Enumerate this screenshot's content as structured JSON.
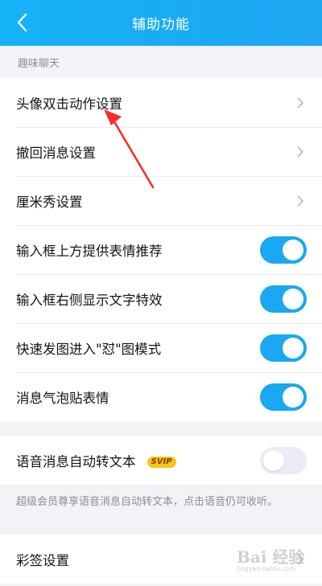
{
  "header": {
    "title": "辅助功能",
    "back_icon": "chevron-left-icon"
  },
  "sections": [
    {
      "header": "趣味聊天",
      "items": [
        {
          "label": "头像双击动作设置",
          "control": "chevron"
        },
        {
          "label": "撤回消息设置",
          "control": "chevron"
        },
        {
          "label": "厘米秀设置",
          "control": "chevron"
        },
        {
          "label": "输入框上方提供表情推荐",
          "control": "toggle",
          "on": true
        },
        {
          "label": "输入框右侧显示文字特效",
          "control": "toggle",
          "on": true
        },
        {
          "label": "快速发图进入\"怼\"图模式",
          "control": "toggle",
          "on": true
        },
        {
          "label": "消息气泡贴表情",
          "control": "toggle",
          "on": true
        }
      ]
    },
    {
      "items": [
        {
          "label": "语音消息自动转文本",
          "badge": "SVIP",
          "control": "toggle",
          "on": false
        }
      ],
      "note": "超级会员尊享语音消息自动转文本，点击语音仍可收听。"
    },
    {
      "items": [
        {
          "label": "彩签设置",
          "control": "chevron"
        }
      ]
    }
  ],
  "watermark": {
    "main": "Bai 经验",
    "sub": "jingyan.baidu.com"
  },
  "colors": {
    "header": "#1aabf4",
    "toggle_on": "#19a8f1",
    "annotation_arrow": "#ff2a2a"
  }
}
